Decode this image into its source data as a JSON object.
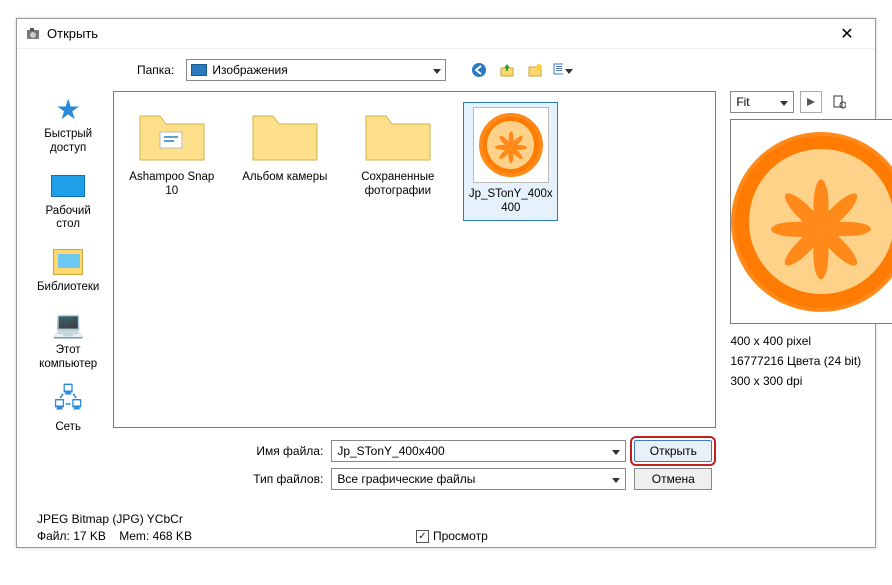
{
  "titlebar": {
    "title": "Открыть",
    "close": "✕"
  },
  "toolbar": {
    "folder_label": "Папка:",
    "folder_current": "Изображения"
  },
  "sidebar": {
    "items": [
      {
        "label": "Быстрый доступ"
      },
      {
        "label": "Рабочий стол"
      },
      {
        "label": "Библиотеки"
      },
      {
        "label": "Этот компьютер"
      },
      {
        "label": "Сеть"
      }
    ]
  },
  "files": {
    "items": [
      {
        "label": "Ashampoo Snap 10",
        "type": "folder"
      },
      {
        "label": "Альбом камеры",
        "type": "folder"
      },
      {
        "label": "Сохраненные фотографии",
        "type": "folder"
      },
      {
        "label": "Jp_STonY_400x400",
        "type": "image",
        "selected": true
      }
    ]
  },
  "preview": {
    "fit_label": "Fit",
    "meta": {
      "dimensions": "400 x 400 pixel",
      "colors": "16777216 Цвета (24 bit)",
      "dpi": "300 x 300 dpi"
    }
  },
  "bottom": {
    "filename_label": "Имя файла:",
    "filename_value": "Jp_STonY_400x400",
    "filetype_label": "Тип файлов:",
    "filetype_value": "Все графические файлы",
    "open_btn": "Открыть",
    "cancel_btn": "Отмена"
  },
  "status": {
    "format": "JPEG Bitmap (JPG) YCbCr",
    "file_label": "Файл:",
    "file_size": "17 KB",
    "mem_label": "Mem:",
    "mem_size": "468 KB",
    "preview_chk": "Просмотр"
  }
}
